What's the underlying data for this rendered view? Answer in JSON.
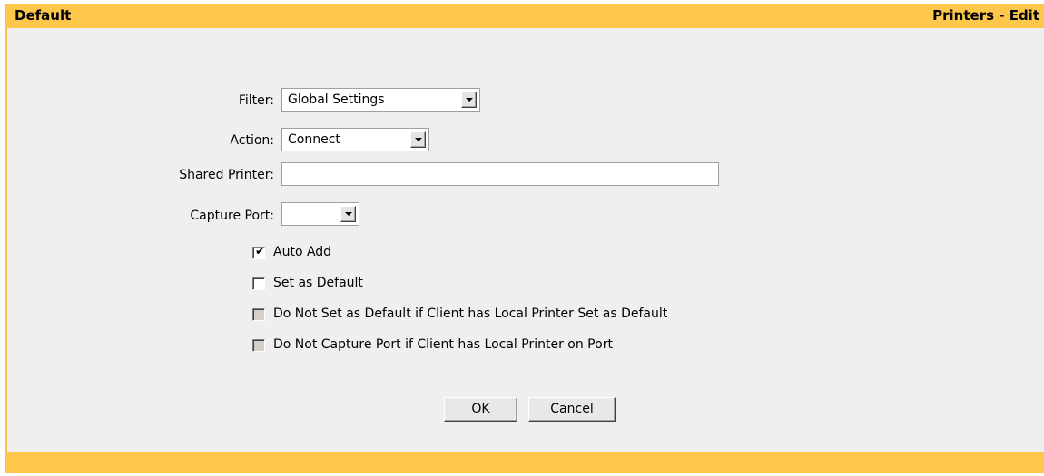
{
  "header": {
    "left_title": "Default",
    "right_title": "Printers - Edit"
  },
  "form": {
    "filter_label": "Filter:",
    "filter_value": "Global Settings",
    "action_label": "Action:",
    "action_value": "Connect",
    "shared_printer_label": "Shared Printer:",
    "shared_printer_value": "",
    "capture_port_label": "Capture Port:",
    "capture_port_value": ""
  },
  "checkboxes": [
    {
      "label": "Auto Add",
      "checked": true,
      "enabled": true
    },
    {
      "label": "Set as Default",
      "checked": false,
      "enabled": true
    },
    {
      "label": "Do Not Set as Default if Client has Local Printer Set as Default",
      "checked": false,
      "enabled": false
    },
    {
      "label": "Do Not Capture Port if Client has Local Printer on Port",
      "checked": false,
      "enabled": false
    }
  ],
  "buttons": {
    "ok_label": "OK",
    "cancel_label": "Cancel"
  },
  "colors": {
    "accent": "#fcc74b",
    "panel": "#efefef"
  }
}
